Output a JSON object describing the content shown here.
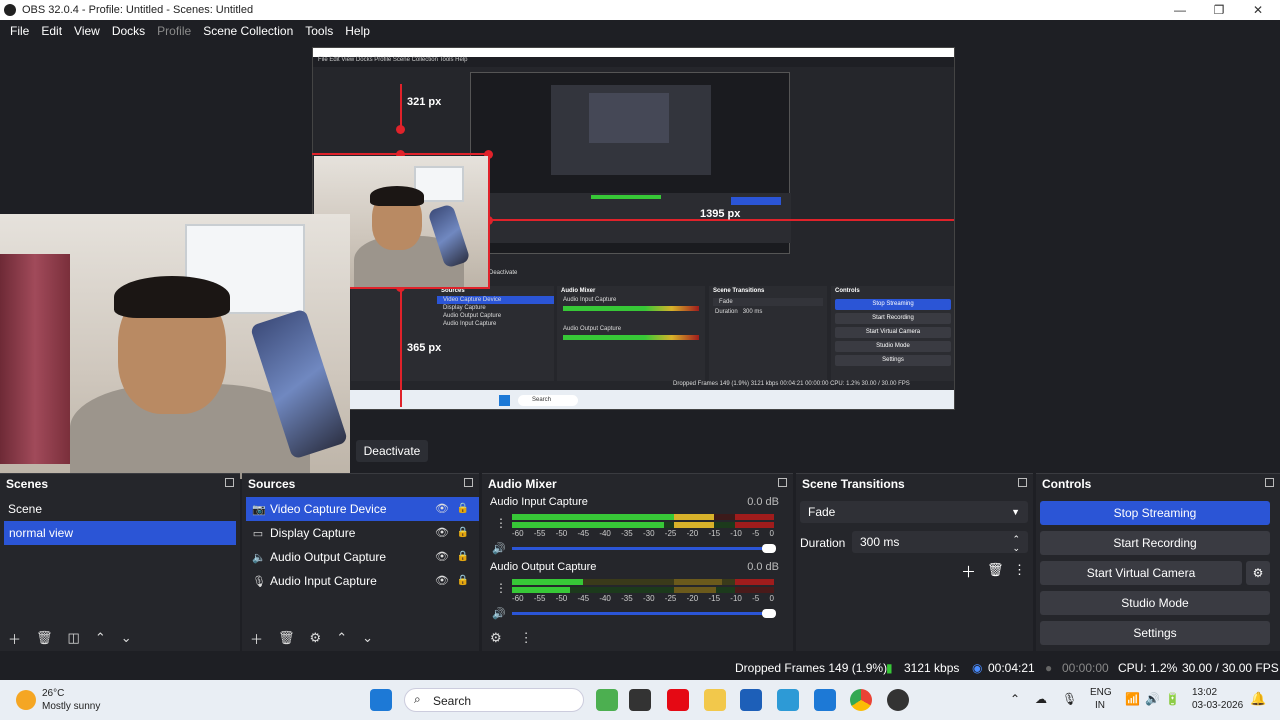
{
  "window": {
    "title": "OBS 32.0.4 - Profile: Untitled - Scenes: Untitled"
  },
  "menu": [
    "File",
    "Edit",
    "View",
    "Docks",
    "Profile",
    "Scene Collection",
    "Tools",
    "Help"
  ],
  "preview": {
    "labels": {
      "top": "321 px",
      "right": "1395 px",
      "left": "365 px"
    },
    "nested": {
      "menu": "File  Edit  View  Docks  Profile  Scene Collection  Tools  Help",
      "deactivate": "Deactivate",
      "sources_title": "Sources",
      "sources": [
        "Video Capture Device",
        "Display Capture",
        "Audio Output Capture",
        "Audio Input Capture"
      ],
      "mixer_title": "Audio Mixer",
      "mixer": [
        "Audio Input Capture",
        "Audio Output Capture"
      ],
      "transitions_title": "Scene Transitions",
      "transition": "Fade",
      "duration_label": "Duration",
      "duration": "300 ms",
      "controls_title": "Controls",
      "controls": [
        "Stop Streaming",
        "Start Recording",
        "Start Virtual Camera",
        "Studio Mode",
        "Settings"
      ],
      "status": "Dropped Frames 149 (1.9%)   3121 kbps   00:04:21   00:00:00   CPU: 1.2%   30.00 / 30.00 FPS",
      "search": "Search"
    }
  },
  "deactivate": "Deactivate",
  "scenes": {
    "title": "Scenes",
    "items": [
      "Scene",
      "normal view"
    ],
    "selected": 1
  },
  "sources": {
    "title": "Sources",
    "items": [
      {
        "name": "Video Capture Device",
        "icon": "camera-icon"
      },
      {
        "name": "Display Capture",
        "icon": "monitor-icon"
      },
      {
        "name": "Audio Output Capture",
        "icon": "speaker-icon"
      },
      {
        "name": "Audio Input Capture",
        "icon": "microphone-icon"
      }
    ],
    "selected": 0
  },
  "mixer": {
    "title": "Audio Mixer",
    "channels": [
      {
        "name": "Audio Input Capture",
        "db": "0.0 dB"
      },
      {
        "name": "Audio Output Capture",
        "db": "0.0 dB"
      }
    ],
    "ticks": [
      "-60",
      "-55",
      "-50",
      "-45",
      "-40",
      "-35",
      "-30",
      "-25",
      "-20",
      "-15",
      "-10",
      "-5",
      "0"
    ]
  },
  "transitions": {
    "title": "Scene Transitions",
    "selected": "Fade",
    "duration_label": "Duration",
    "duration": "300 ms"
  },
  "controls": {
    "title": "Controls",
    "buttons": [
      "Stop Streaming",
      "Start Recording",
      "Start Virtual Camera",
      "Studio Mode",
      "Settings"
    ]
  },
  "status": {
    "dropped": "Dropped Frames 149 (1.9%)",
    "kbps": "3121 kbps",
    "stream_time": "00:04:21",
    "rec_time": "00:00:00",
    "cpu": "CPU: 1.2%",
    "fps": "30.00 / 30.00 FPS"
  },
  "taskbar": {
    "weather_temp": "26°C",
    "weather_desc": "Mostly sunny",
    "search": "Search",
    "lang_top": "ENG",
    "lang_bottom": "IN",
    "time": "13:02",
    "date": "03-03-2026"
  },
  "colors": {
    "accent": "#2b55d6",
    "guide": "#e0222a",
    "panel": "#25262b",
    "bg": "#1e1f24"
  }
}
